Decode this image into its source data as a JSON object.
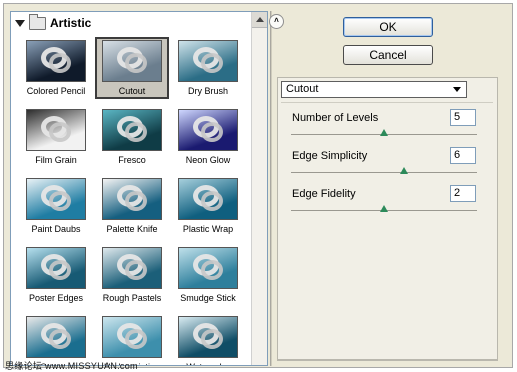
{
  "gallery": {
    "folder_label": "Artistic",
    "thumbnails": [
      {
        "label": "Colored Pencil",
        "colors": [
          "#0f1a2a",
          "#8aa0b8"
        ]
      },
      {
        "label": "Cutout",
        "colors": [
          "#6b7e8e",
          "#d8e0e6"
        ]
      },
      {
        "label": "Dry Brush",
        "colors": [
          "#2b6d86",
          "#cfe3ea"
        ]
      },
      {
        "label": "Film Grain",
        "colors": [
          "#f2f2f2",
          "#2d2d2d"
        ]
      },
      {
        "label": "Fresco",
        "colors": [
          "#0f3c46",
          "#5bb6c4"
        ]
      },
      {
        "label": "Neon Glow",
        "colors": [
          "#1a1a70",
          "#cfd7ff"
        ]
      },
      {
        "label": "Paint Daubs",
        "colors": [
          "#1f7da3",
          "#e8f2f6"
        ]
      },
      {
        "label": "Palette Knife",
        "colors": [
          "#155f80",
          "#f4f4f4"
        ]
      },
      {
        "label": "Plastic Wrap",
        "colors": [
          "#0f5f7f",
          "#a6cfdc"
        ]
      },
      {
        "label": "Poster Edges",
        "colors": [
          "#175a74",
          "#b6e0ee"
        ]
      },
      {
        "label": "Rough Pastels",
        "colors": [
          "#1b5f79",
          "#dfe9ed"
        ]
      },
      {
        "label": "Smudge Stick",
        "colors": [
          "#2e7f9c",
          "#bfe0ea"
        ]
      },
      {
        "label": "Sponge",
        "colors": [
          "#1a6e8f",
          "#eaeaea"
        ]
      },
      {
        "label": "Underpainting",
        "colors": [
          "#3d8fac",
          "#cde6ee"
        ]
      },
      {
        "label": "Watercolor",
        "colors": [
          "#0f4d66",
          "#d9ecf2"
        ]
      }
    ],
    "selected": "Cutout"
  },
  "buttons": {
    "ok": "OK",
    "cancel": "Cancel"
  },
  "filter_select": {
    "value": "Cutout"
  },
  "params": [
    {
      "label": "Number of Levels",
      "value": "5",
      "slider_fraction": 0.5
    },
    {
      "label": "Edge Simplicity",
      "value": "6",
      "slider_fraction": 0.61
    },
    {
      "label": "Edge Fidelity",
      "value": "2",
      "slider_fraction": 0.5
    }
  ],
  "watermark": {
    "text": "思缘论坛",
    "url": "www.MISSYUAN.com"
  },
  "colors": {
    "dialog_bg": "#ece9d8",
    "slider_knob": "#2c8a5a",
    "ok_border": "#2f5f9c"
  }
}
